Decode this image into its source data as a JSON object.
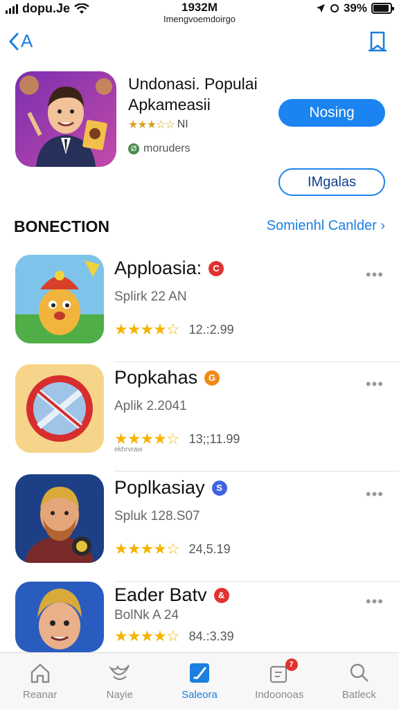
{
  "status_bar": {
    "carrier": "dopu.Je",
    "time": "1932M",
    "subtitle": "Imengvoemdoirgo",
    "battery": "39%"
  },
  "nav": {
    "back_label": "A"
  },
  "featured": {
    "title": "Undonasi. Populai Apkameasii",
    "rating_text": "NI",
    "developer": "moruders",
    "primary_button": "Nosing",
    "secondary_button": "IMgalas"
  },
  "section": {
    "title": "BONECTION",
    "link": "Somienhl Canlder ›"
  },
  "apps": [
    {
      "name": "Apploasia:",
      "subtitle": "Splirk 22 AN",
      "rating": 4.5,
      "price": "12.:2.99",
      "badge_color": "#e0322f",
      "badge_glyph": "C"
    },
    {
      "name": "Popkahas",
      "subtitle": "Aplik 2.2041",
      "rating": 4.5,
      "price": "13;;11.99",
      "badge_color": "#f08a16",
      "badge_glyph": "G",
      "tiny": "ekhrvraw"
    },
    {
      "name": "Poplkasiay",
      "subtitle": "Spluk 128.S07",
      "rating": 4.5,
      "price": "24,5.19",
      "badge_color": "#3f64e3",
      "badge_glyph": "S"
    },
    {
      "name": "Eader Batv",
      "subtitle": "BolNk A 24",
      "rating": 4.5,
      "price": "84.:3.39",
      "badge_color": "#e0322f",
      "badge_glyph": "&"
    }
  ],
  "tabs": [
    {
      "label": "Reanar",
      "icon": "home-icon"
    },
    {
      "label": "Nayie",
      "icon": "bird-icon"
    },
    {
      "label": "Saleora",
      "icon": "check-icon"
    },
    {
      "label": "Indoonoas",
      "icon": "badge-box-icon",
      "badge": "7"
    },
    {
      "label": "Batleck",
      "icon": "search-icon"
    }
  ],
  "colors": {
    "accent": "#1a7fe0",
    "star": "#f5b400"
  }
}
